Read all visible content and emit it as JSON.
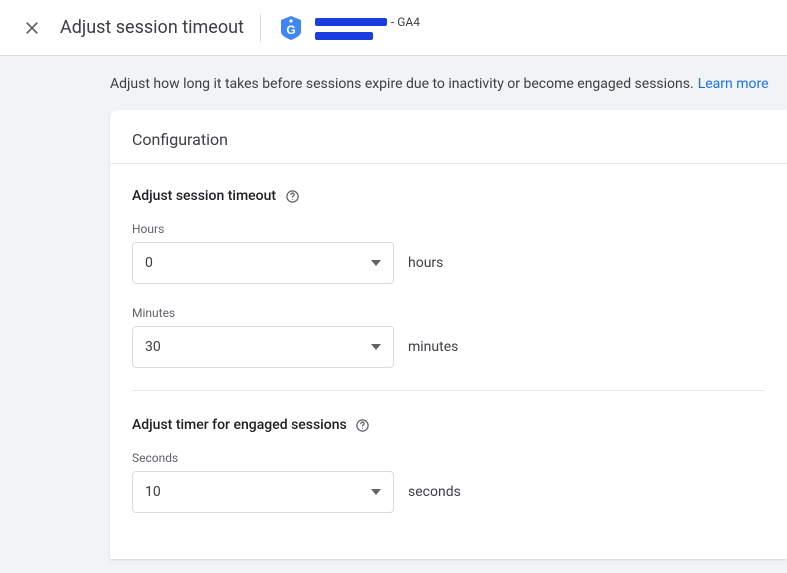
{
  "header": {
    "title": "Adjust session timeout",
    "property_suffix": "- GA4"
  },
  "description": {
    "text": "Adjust how long it takes before sessions expire due to inactivity or become engaged sessions.",
    "learn_more": "Learn more"
  },
  "card": {
    "title": "Configuration",
    "session_timeout": {
      "heading": "Adjust session timeout",
      "hours_label": "Hours",
      "hours_value": "0",
      "hours_unit": "hours",
      "minutes_label": "Minutes",
      "minutes_value": "30",
      "minutes_unit": "minutes"
    },
    "engaged": {
      "heading": "Adjust timer for engaged sessions",
      "seconds_label": "Seconds",
      "seconds_value": "10",
      "seconds_unit": "seconds"
    }
  }
}
